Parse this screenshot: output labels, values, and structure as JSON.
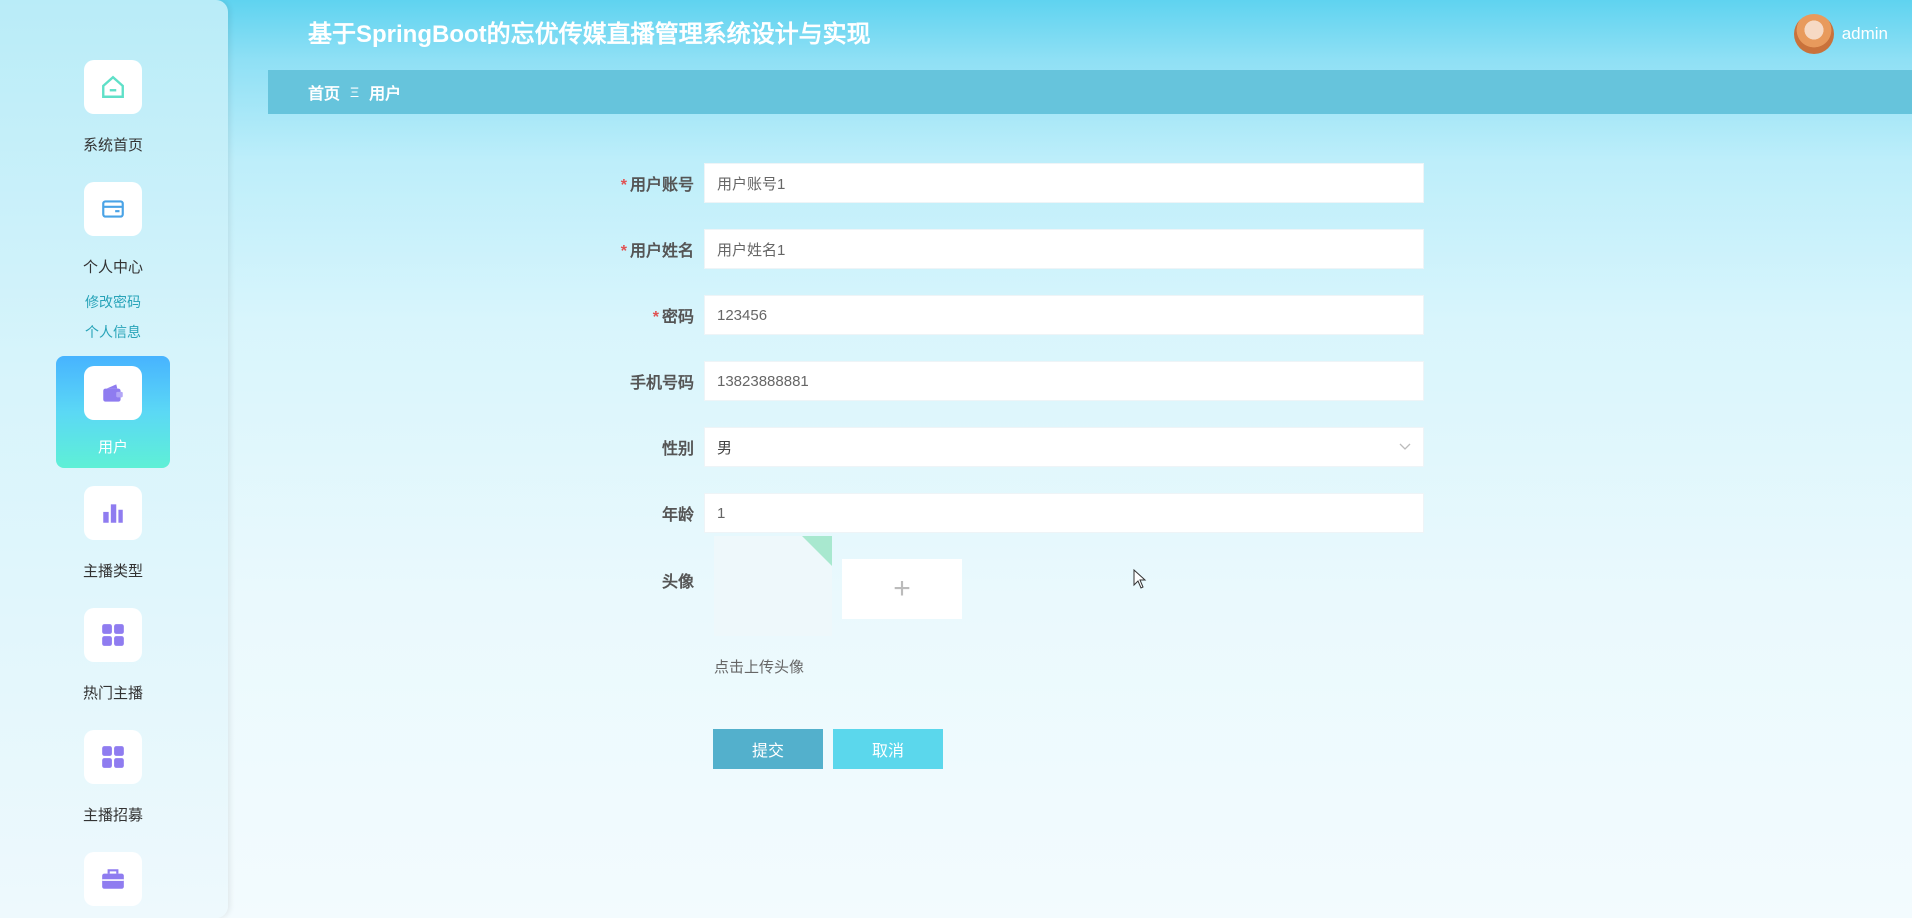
{
  "header": {
    "title": "基于SpringBoot的忘优传媒直播管理系统设计与实现",
    "username": "admin"
  },
  "breadcrumb": {
    "home": "首页",
    "separator": "Ξ",
    "current": "用户"
  },
  "sidebar": {
    "items": [
      {
        "label": "系统首页",
        "icon": "home-icon"
      },
      {
        "label": "个人中心",
        "icon": "wallet-card-icon"
      },
      {
        "label": "用户",
        "icon": "wallet-icon",
        "active": true
      },
      {
        "label": "主播类型",
        "icon": "bar-chart-icon"
      },
      {
        "label": "热门主播",
        "icon": "grid-icon"
      },
      {
        "label": "主播招募",
        "icon": "grid-icon"
      },
      {
        "label": "",
        "icon": "briefcase-icon"
      }
    ],
    "sub_links": [
      "修改密码",
      "个人信息"
    ]
  },
  "form": {
    "account": {
      "label": "用户账号",
      "value": "用户账号1",
      "required": true
    },
    "name": {
      "label": "用户姓名",
      "value": "用户姓名1",
      "required": true
    },
    "password": {
      "label": "密码",
      "value": "123456",
      "required": true
    },
    "phone": {
      "label": "手机号码",
      "value": "13823888881"
    },
    "gender": {
      "label": "性别",
      "value": "男"
    },
    "age": {
      "label": "年龄",
      "value": "1"
    },
    "avatar": {
      "label": "头像",
      "upload_plus": "+",
      "hint": "点击上传头像"
    }
  },
  "buttons": {
    "submit": "提交",
    "cancel": "取消"
  },
  "colors": {
    "accent": "#5bd7ec",
    "submit": "#53b0cc",
    "required": "#e05252",
    "sidebar_active": "#47b3ff"
  }
}
